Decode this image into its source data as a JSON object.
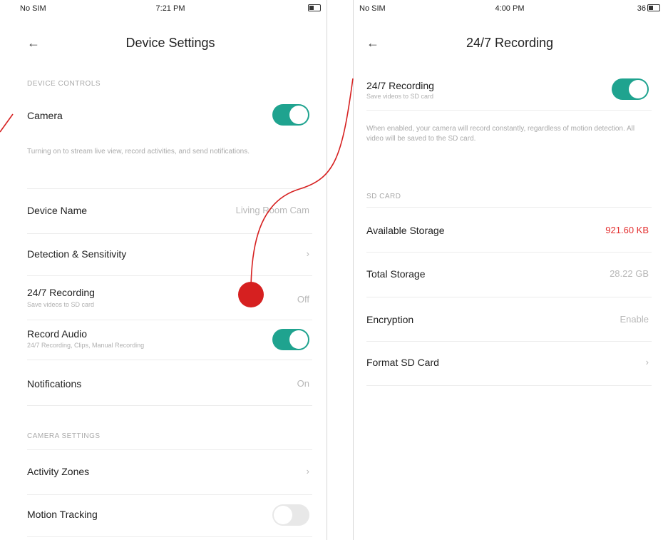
{
  "left": {
    "status": {
      "carrier": "No SIM",
      "time": "7:21 PM",
      "battery": "■"
    },
    "title": "Device Settings",
    "back_icon": "←",
    "device_controls_header": "DEVICE CONTROLS",
    "camera": {
      "label": "Camera",
      "on": true
    },
    "camera_desc": "Turning on to stream live view, record activities, and send notifications.",
    "device_name": {
      "label": "Device Name",
      "value": "Living Room Cam"
    },
    "detection": {
      "label": "Detection & Sensitivity",
      "chevron": "›"
    },
    "recording": {
      "label": "24/7 Recording",
      "sub": "Save videos to SD card",
      "value": "Off"
    },
    "record_audio": {
      "label": "Record Audio",
      "sub": "24/7 Recording, Clips, Manual Recording",
      "on": true
    },
    "notifications": {
      "label": "Notifications",
      "value": "On"
    },
    "camera_settings_header": "CAMERA SETTINGS",
    "activity_zones": {
      "label": "Activity Zones"
    },
    "motion_tracking": {
      "label": "Motion Tracking",
      "on": false
    }
  },
  "right": {
    "status": {
      "carrier": "No SIM",
      "time": "4:00 PM",
      "battery": "36"
    },
    "title": "24/7 Recording",
    "back_icon": "←",
    "recording": {
      "label": "24/7 Recording",
      "sub": "Save videos to SD card",
      "on": true
    },
    "recording_desc": "When enabled, your camera will record constantly, regardless of motion detection. All video will be saved to the SD card.",
    "sd_card_header": "SD CARD",
    "available": {
      "label": "Available Storage",
      "value": "921.60 KB"
    },
    "total": {
      "label": "Total Storage",
      "value": "28.22 GB"
    },
    "encryption": {
      "label": "Encryption",
      "value": "Enable"
    },
    "format": {
      "label": "Format SD Card"
    }
  },
  "colors": {
    "accent": "#1fa38f",
    "warning": "#e32d2d",
    "annotation": "#d62020"
  }
}
